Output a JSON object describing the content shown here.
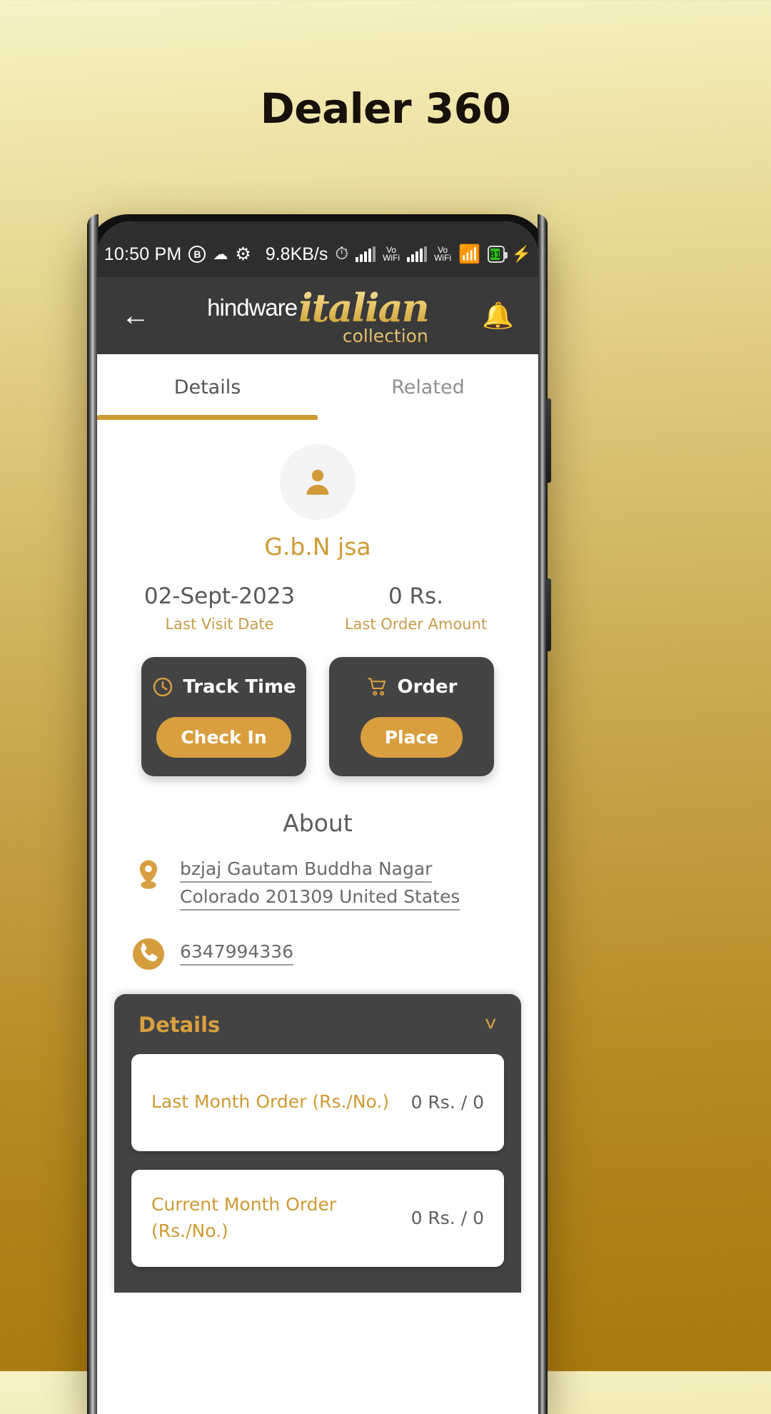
{
  "page": {
    "title": "Dealer 360"
  },
  "status_bar": {
    "time": "10:50 PM",
    "badge_letter": "B",
    "cloud_icon": "cloud-icon",
    "gear_icon": "gear-icon",
    "data_speed": "9.8KB/s",
    "alarm_icon": "alarm-icon",
    "signal1_label": "Vo\nWiFi",
    "volte_top": "Vo",
    "volte_bottom": "WiFi",
    "wifi_icon": "wifi-icon",
    "battery_percent": "81",
    "charging_icon": "bolt-icon"
  },
  "appbar": {
    "back_icon": "back-arrow-icon",
    "logo_brand": "hindware",
    "logo_script": "italian",
    "logo_sub": "collection",
    "bell_icon": "bell-icon"
  },
  "tabs": [
    {
      "label": "Details",
      "active": true
    },
    {
      "label": "Related",
      "active": false
    }
  ],
  "profile": {
    "avatar_icon": "person-icon",
    "name": "G.b.N jsa"
  },
  "stats": [
    {
      "value": "02-Sept-2023",
      "label": "Last Visit Date"
    },
    {
      "value": "0 Rs.",
      "label": "Last Order Amount"
    }
  ],
  "action_cards": [
    {
      "icon": "clock-icon",
      "title": "Track Time",
      "button": "Check In"
    },
    {
      "icon": "cart-icon",
      "title": "Order",
      "button": "Place"
    }
  ],
  "about": {
    "heading": "About",
    "location_icon": "location-pin-icon",
    "address": "bzjaj Gautam Buddha Nagar Colorado 201309 United States",
    "phone_icon": "phone-icon",
    "phone": "6347994336"
  },
  "details_panel": {
    "title": "Details",
    "chevron_icon": "chevron-down-icon",
    "rows": [
      {
        "label": "Last Month Order (Rs./No.)",
        "value": "0 Rs. / 0"
      },
      {
        "label": "Current Month Order (Rs./No.)",
        "value": "0 Rs. / 0"
      }
    ]
  },
  "colors": {
    "accent_gold": "#cf9a33",
    "card_dark": "#434343",
    "battery_green": "#31c218"
  }
}
